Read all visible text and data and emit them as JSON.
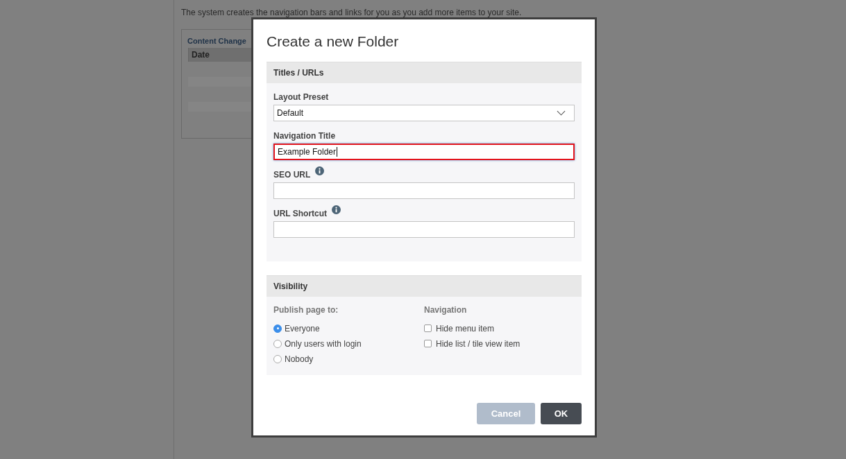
{
  "page": {
    "intro_lines": [
      "The system creates the navigation bars and links for you as you add more items to your site."
    ],
    "panel": {
      "title": "Content Change",
      "columns": [
        "Date"
      ]
    }
  },
  "dialog": {
    "title": "Create a new Folder",
    "sections": [
      {
        "heading": "Titles / URLs",
        "fields": [
          {
            "kind": "select",
            "label": "Layout Preset",
            "value": "Default",
            "info": false,
            "focused": false
          },
          {
            "kind": "text",
            "label": "Navigation Title",
            "value": "Example Folder",
            "info": false,
            "focused": true
          },
          {
            "kind": "text",
            "label": "SEO URL",
            "info": true,
            "focused": false
          },
          {
            "kind": "text",
            "label": "URL Shortcut",
            "info": true,
            "focused": false
          }
        ]
      },
      {
        "heading": "Visibility",
        "publish": {
          "label": "Publish page to:",
          "options": [
            {
              "label": "Everyone",
              "selected": true
            },
            {
              "label": "Only users with login",
              "selected": false
            },
            {
              "label": "Nobody",
              "selected": false
            }
          ]
        },
        "navigation": {
          "label": "Navigation",
          "options": [
            {
              "label": "Hide menu item",
              "checked": false
            },
            {
              "label": "Hide list / tile view item",
              "checked": false
            }
          ]
        }
      }
    ],
    "buttons": [
      {
        "label": "Cancel",
        "kind": "secondary",
        "disabled": true
      },
      {
        "label": "OK",
        "kind": "primary",
        "disabled": false
      }
    ]
  }
}
